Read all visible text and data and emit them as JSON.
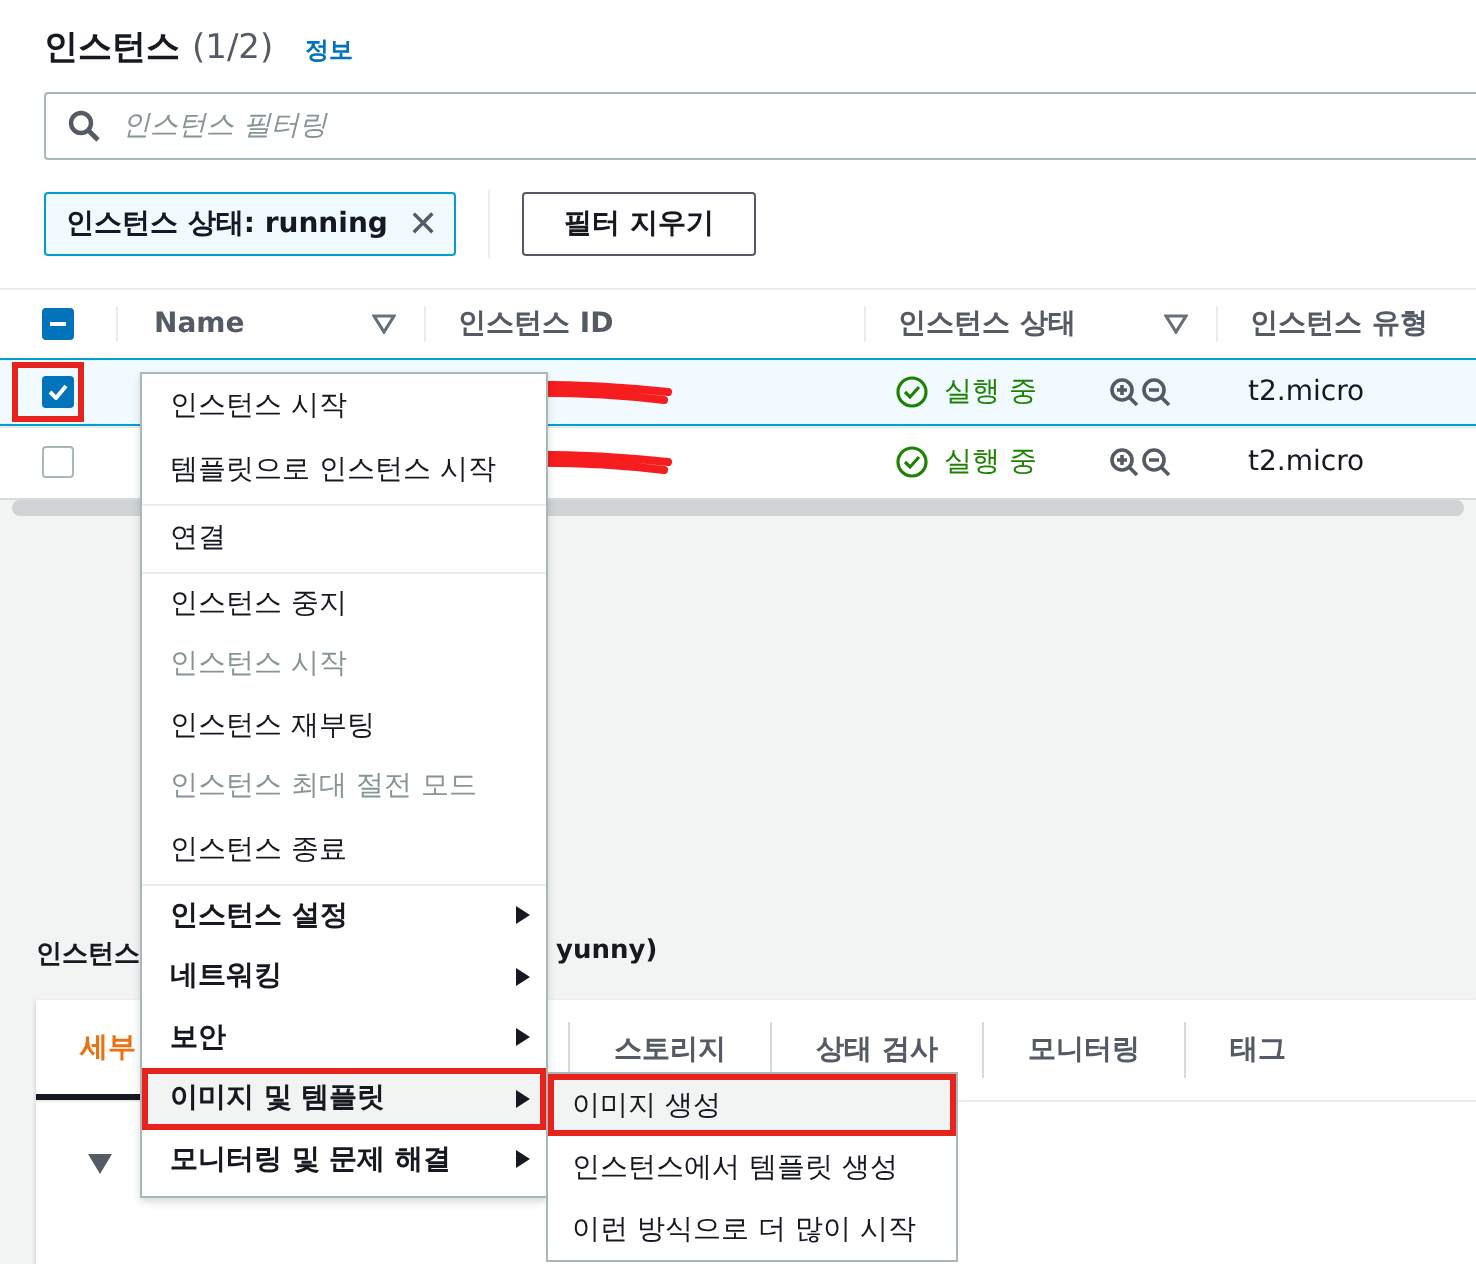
{
  "header": {
    "title": "인스턴스",
    "count": "(1/2)",
    "info_link": "정보"
  },
  "search": {
    "placeholder": "인스턴스 필터링"
  },
  "filter_token": {
    "label": "인스턴스 상태: running",
    "remove": "✕"
  },
  "clear_filters": "필터 지우기",
  "table": {
    "select_all": {
      "indeterminate": true
    },
    "columns": [
      {
        "label": "Name",
        "filter": true
      },
      {
        "label": "인스턴스 ID",
        "filter": false
      },
      {
        "label": "인스턴스 상태",
        "filter": true
      },
      {
        "label": "인스턴스 유형",
        "filter": false
      }
    ],
    "rows": [
      {
        "selected": true,
        "annotated": true,
        "state": "실행 중",
        "type": "t2.micro"
      },
      {
        "selected": false,
        "annotated": false,
        "state": "실행 중",
        "type": "t2.micro"
      }
    ]
  },
  "details": {
    "title_start": "인스턴스",
    "title_end": "yunny)",
    "tabs": [
      {
        "label": "세부",
        "selected": true
      },
      {
        "label": "스토리지",
        "selected": false
      },
      {
        "label": "상태 검사",
        "selected": false
      },
      {
        "label": "모니터링",
        "selected": false
      },
      {
        "label": "태그",
        "selected": false
      }
    ]
  },
  "context_menu": [
    {
      "label": "인스턴스 시작",
      "disabled": false,
      "bold": false,
      "submenu": false,
      "divider_after": false,
      "highlighted": false
    },
    {
      "label": "템플릿으로 인스턴스 시작",
      "disabled": false,
      "bold": false,
      "submenu": false,
      "divider_after": true,
      "highlighted": false
    },
    {
      "label": "연결",
      "disabled": false,
      "bold": false,
      "submenu": false,
      "divider_after": true,
      "highlighted": false
    },
    {
      "label": "인스턴스 중지",
      "disabled": false,
      "bold": false,
      "submenu": false,
      "divider_after": false,
      "highlighted": false
    },
    {
      "label": "인스턴스 시작",
      "disabled": true,
      "bold": false,
      "submenu": false,
      "divider_after": false,
      "highlighted": false
    },
    {
      "label": "인스턴스 재부팅",
      "disabled": false,
      "bold": false,
      "submenu": false,
      "divider_after": false,
      "highlighted": false
    },
    {
      "label": "인스턴스 최대 절전 모드",
      "disabled": true,
      "bold": false,
      "submenu": false,
      "divider_after": false,
      "highlighted": false
    },
    {
      "label": "인스턴스 종료",
      "disabled": false,
      "bold": false,
      "submenu": false,
      "divider_after": true,
      "highlighted": false
    },
    {
      "label": "인스턴스 설정",
      "disabled": false,
      "bold": true,
      "submenu": true,
      "divider_after": false,
      "highlighted": false
    },
    {
      "label": "네트워킹",
      "disabled": false,
      "bold": true,
      "submenu": true,
      "divider_after": false,
      "highlighted": false
    },
    {
      "label": "보안",
      "disabled": false,
      "bold": true,
      "submenu": true,
      "divider_after": false,
      "highlighted": false
    },
    {
      "label": "이미지 및 템플릿",
      "disabled": false,
      "bold": true,
      "submenu": true,
      "divider_after": false,
      "highlighted": true
    },
    {
      "label": "모니터링 및 문제 해결",
      "disabled": false,
      "bold": true,
      "submenu": true,
      "divider_after": false,
      "highlighted": false
    }
  ],
  "submenu": [
    {
      "label": "이미지 생성",
      "highlighted": true
    },
    {
      "label": "인스턴스에서 템플릿 생성",
      "highlighted": false
    },
    {
      "label": "이런 방식으로 더 많이 시작",
      "highlighted": false
    }
  ]
}
